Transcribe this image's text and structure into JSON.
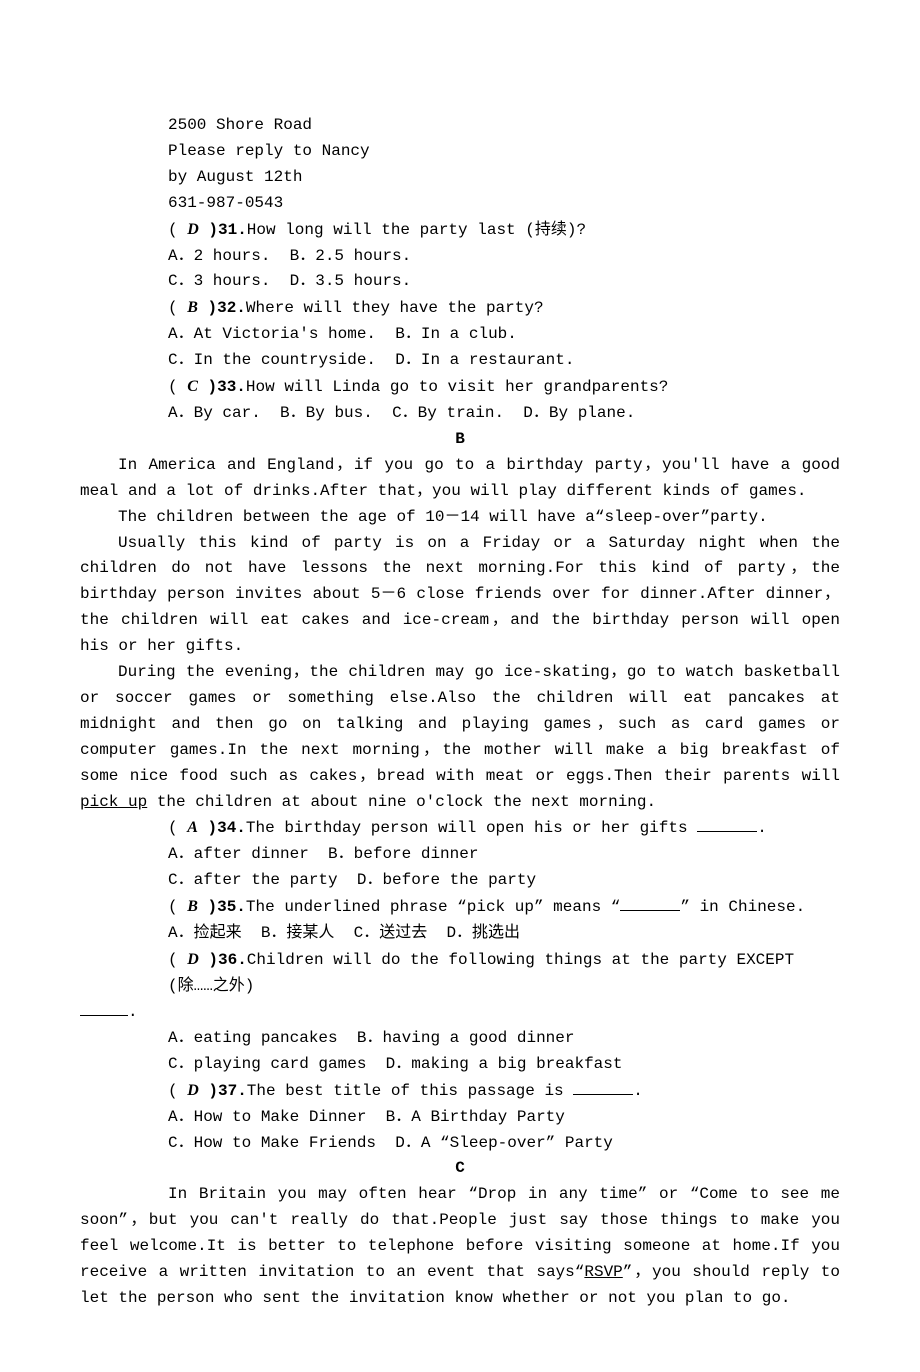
{
  "intro": {
    "l1": "2500 Shore Road",
    "l2": "Please reply to Nancy",
    "l3": "by August 12th",
    "l4": "631-987-0543"
  },
  "q31": {
    "label": "(",
    "ans": "D",
    "label2": ")31.",
    "text": "How long will the party last (持续)?",
    "a": "A．2 hours.",
    "b": "B．2.5 hours.",
    "c": "C．3 hours.",
    "d": "D．3.5 hours."
  },
  "q32": {
    "label": "(",
    "ans": "B",
    "label2": ")32.",
    "text": "Where will they have the party?",
    "a": "A．At Victoria's home.",
    "b": "B．In a club.",
    "c": "C．In the countryside.",
    "d": "D．In a restaurant."
  },
  "q33": {
    "label": "(",
    "ans": "C",
    "label2": ")33.",
    "text": "How will Linda go to visit her grandparents?",
    "a": "A．By car.",
    "b": "B．By bus.",
    "c": "C．By train.",
    "d": "D．By plane."
  },
  "sectionB": {
    "heading": "B",
    "p1_a": "In America and England，if you go to a birthday party，you'll have a good meal and a lot of drinks.After that，you will play different kinds of games.",
    "p2": "The children between the age of 10－14 will have a“sleep-over”party.",
    "p3": "Usually this kind of party is on a Friday or a Saturday night when the children do not have lessons the next morning.For this kind of party，the birthday person invites about 5－6 close friends over for dinner.After dinner，the children will eat cakes and ice-cream，and the birthday person will open his or her gifts.",
    "p4_a": "During the evening，the children may go ice-skating，go to watch basketball or soccer games or something else.Also the children will eat pancakes at midnight and then go on talking and playing games，such as card games or computer games.In the next morning，the mother will make a big breakfast of some nice food such as cakes，bread with meat or eggs.Then their parents will ",
    "p4_u": "pick up",
    "p4_b": " the children at about nine o'clock the next morning."
  },
  "q34": {
    "label": "(",
    "ans": "A",
    "label2": ")34.",
    "text": "The birthday person will open his or her gifts ",
    "tail": ".",
    "a": "A．after dinner",
    "b": "B．before dinner",
    "c": "C．after the party",
    "d": "D．before the party"
  },
  "q35": {
    "label": "(",
    "ans": "B",
    "label2": ")35.",
    "text": "The underlined phrase “pick up” means “",
    "tail": "” in Chinese.",
    "a": "A．捡起来",
    "b": "B．接某人",
    "c": "C．送过去",
    "d": "D．挑选出"
  },
  "q36": {
    "label": "(",
    "ans": "D",
    "label2": ")36.",
    "text": "Children will do the following things at the party EXCEPT (除……之外)",
    "tail": ".",
    "a": "A．eating pancakes",
    "b": "B．having a good dinner",
    "c": "C．playing card games",
    "d": "D．making a big breakfast"
  },
  "q37": {
    "label": "(",
    "ans": "D",
    "label2": ")37.",
    "text": "The best title of this passage is ",
    "tail": ".",
    "a": "A．How to Make Dinner",
    "b": "B．A Birthday Party",
    "c": "C．How to Make Friends",
    "d": "D．A “Sleep-over” Party"
  },
  "sectionC": {
    "heading": "C",
    "p1_a": "In Britain you may often hear “Drop in any time” or “Come to see me soon”，but you can't really do that.People just say those things to make you feel welcome.It is better to telephone before visiting someone at home.If you receive a written invitation to an event that says“",
    "p1_u": "RSVP",
    "p1_b": "”，you should reply to let the person who sent the invitation know whether or not you plan to go."
  }
}
